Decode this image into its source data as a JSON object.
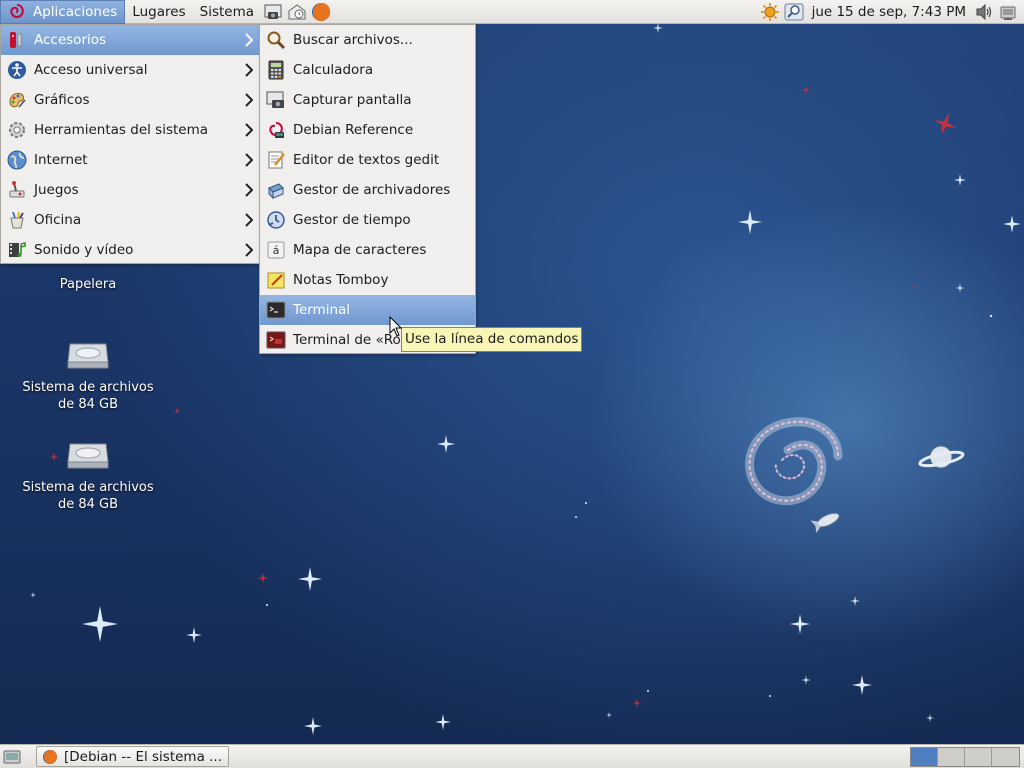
{
  "top_panel": {
    "menus": [
      "Aplicaciones",
      "Lugares",
      "Sistema"
    ],
    "launchers": [
      "screenshot-icon",
      "mail-icon",
      "firefox-icon"
    ],
    "clock": "jue 15 de sep,  7:43 PM"
  },
  "applications_menu": {
    "items": [
      {
        "label": "Accesorios",
        "icon": "accessories-icon",
        "selected": true
      },
      {
        "label": "Acceso universal",
        "icon": "accessibility-icon"
      },
      {
        "label": "Gráficos",
        "icon": "graphics-icon"
      },
      {
        "label": "Herramientas del sistema",
        "icon": "system-tools-icon"
      },
      {
        "label": "Internet",
        "icon": "internet-icon"
      },
      {
        "label": "Juegos",
        "icon": "games-icon"
      },
      {
        "label": "Oficina",
        "icon": "office-icon"
      },
      {
        "label": "Sonido y vídeo",
        "icon": "multimedia-icon"
      }
    ]
  },
  "accessories_menu": {
    "items": [
      {
        "label": "Buscar archivos...",
        "icon": "search-icon"
      },
      {
        "label": "Calculadora",
        "icon": "calculator-icon"
      },
      {
        "label": "Capturar pantalla",
        "icon": "screenshot-icon"
      },
      {
        "label": "Debian Reference",
        "icon": "debian-reference-icon"
      },
      {
        "label": "Editor de textos gedit",
        "icon": "text-editor-icon"
      },
      {
        "label": "Gestor de archivadores",
        "icon": "archive-manager-icon"
      },
      {
        "label": "Gestor de tiempo",
        "icon": "time-tracker-icon"
      },
      {
        "label": "Mapa de caracteres",
        "icon": "character-map-icon"
      },
      {
        "label": "Notas Tomboy",
        "icon": "tomboy-icon"
      },
      {
        "label": "Terminal",
        "icon": "terminal-icon",
        "selected": true
      },
      {
        "label": "Terminal de «Root»",
        "icon": "root-terminal-icon"
      }
    ]
  },
  "tooltip": "Use la línea de comandos",
  "desktop_icons": [
    {
      "label": "Papelera"
    },
    {
      "label": "Sistema de archivos de 84 GB"
    },
    {
      "label": "Sistema de archivos de 84 GB"
    }
  ],
  "taskbar": {
    "window_title": "[Debian -- El sistema ...",
    "workspaces": 4,
    "active_workspace": 1
  },
  "colors": {
    "selection": "#7199cf",
    "tooltip_bg": "#f9f5b4",
    "desktop": "#1e3d70"
  }
}
